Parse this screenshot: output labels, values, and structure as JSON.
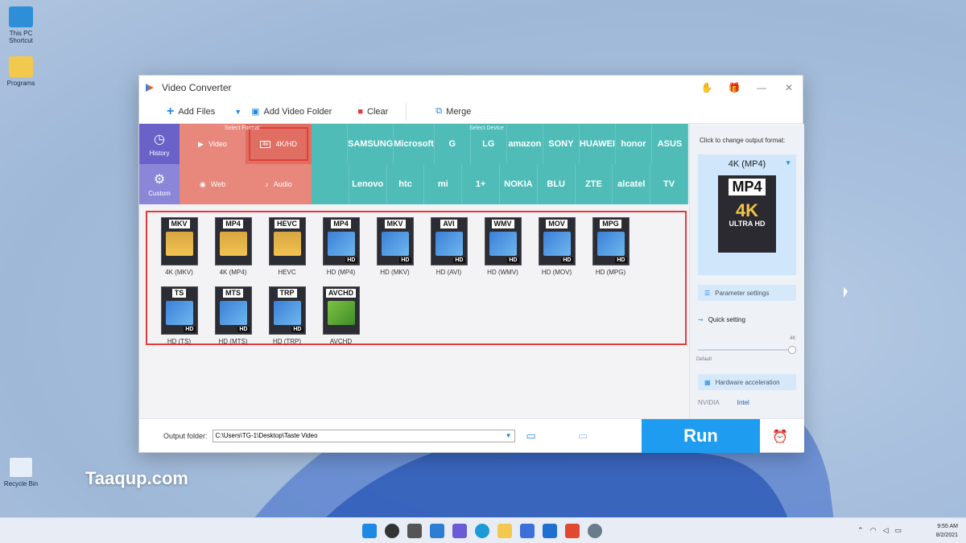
{
  "desktop": {
    "icons": [
      {
        "label": "This PC Shortcut",
        "icon": "pc-icon"
      },
      {
        "label": "Programs",
        "icon": "folder-icon"
      },
      {
        "label": "Recycle Bin",
        "icon": "recycle-bin-icon"
      }
    ],
    "watermark": "Taaqup.com"
  },
  "window": {
    "title": "Video Converter",
    "toolbar": {
      "add_files": "Add Files",
      "add_video_folder": "Add Video Folder",
      "clear": "Clear",
      "merge": "Merge"
    },
    "select_format_label": "Select Format",
    "select_device_label": "Select Device",
    "left_nav": [
      {
        "label": "History",
        "icon": "history-icon"
      },
      {
        "label": "Custom",
        "icon": "custom-icon"
      }
    ],
    "format_types": [
      {
        "label": "Video",
        "icon": "play-icon"
      },
      {
        "label": "4K/HD",
        "icon": "4k-icon",
        "selected": true
      },
      {
        "label": "Web",
        "icon": "web-icon"
      },
      {
        "label": "Audio",
        "icon": "audio-icon"
      }
    ],
    "devices_row1": [
      "",
      "SAMSUNG",
      "Microsoft",
      "G",
      "LG",
      "amazon",
      "SONY",
      "HUAWEI",
      "honor",
      "ASUS"
    ],
    "devices_row2": [
      "",
      "Lenovo",
      "htc",
      "mi",
      "1+",
      "NOKIA",
      "BLU",
      "ZTE",
      "alcatel",
      "TV"
    ],
    "formats": [
      {
        "tag": "MKV",
        "label": "4K (MKV)",
        "art": "k4"
      },
      {
        "tag": "MP4",
        "label": "4K (MP4)",
        "art": "k4"
      },
      {
        "tag": "HEVC",
        "label": "HEVC",
        "art": "k4"
      },
      {
        "tag": "MP4",
        "label": "HD (MP4)",
        "art": "hd"
      },
      {
        "tag": "MKV",
        "label": "HD (MKV)",
        "art": "hd"
      },
      {
        "tag": "AVI",
        "label": "HD (AVI)",
        "art": "hd"
      },
      {
        "tag": "WMV",
        "label": "HD (WMV)",
        "art": "hd"
      },
      {
        "tag": "MOV",
        "label": "HD (MOV)",
        "art": "hd"
      },
      {
        "tag": "MPG",
        "label": "HD (MPG)",
        "art": "hd"
      },
      {
        "tag": "TS",
        "label": "HD (TS)",
        "art": "hd"
      },
      {
        "tag": "MTS",
        "label": "HD (MTS)",
        "art": "hd"
      },
      {
        "tag": "TRP",
        "label": "HD (TRP)",
        "art": "hd"
      },
      {
        "tag": "AVCHD",
        "label": "AVCHD",
        "art": "film"
      }
    ],
    "output": {
      "label": "Output folder:",
      "path": "C:\\Users\\TG-1\\Desktop\\Taste Video"
    },
    "run_label": "Run",
    "right_panel": {
      "hint": "Click to change output format:",
      "output_format": "4K (MP4)",
      "big_tag": "MP4",
      "big_4k": "4K",
      "big_ultra": "ULTRA HD",
      "parameter_settings": "Parameter settings",
      "quick_setting": "Quick setting",
      "slider_default": "Default",
      "slider_max": "4K",
      "hardware_accel": "Hardware acceleration",
      "nvidia": "NVIDIA",
      "intel": "Intel"
    }
  },
  "taskbar": {
    "time": "9:55 AM",
    "date": "8/2/2021"
  },
  "colors": {
    "run": "#1e9cf0",
    "format_section": "#e8877c",
    "device_section": "#4fbcb8",
    "nav_section": "#8b86d8",
    "selection_border": "#e23b3b"
  }
}
